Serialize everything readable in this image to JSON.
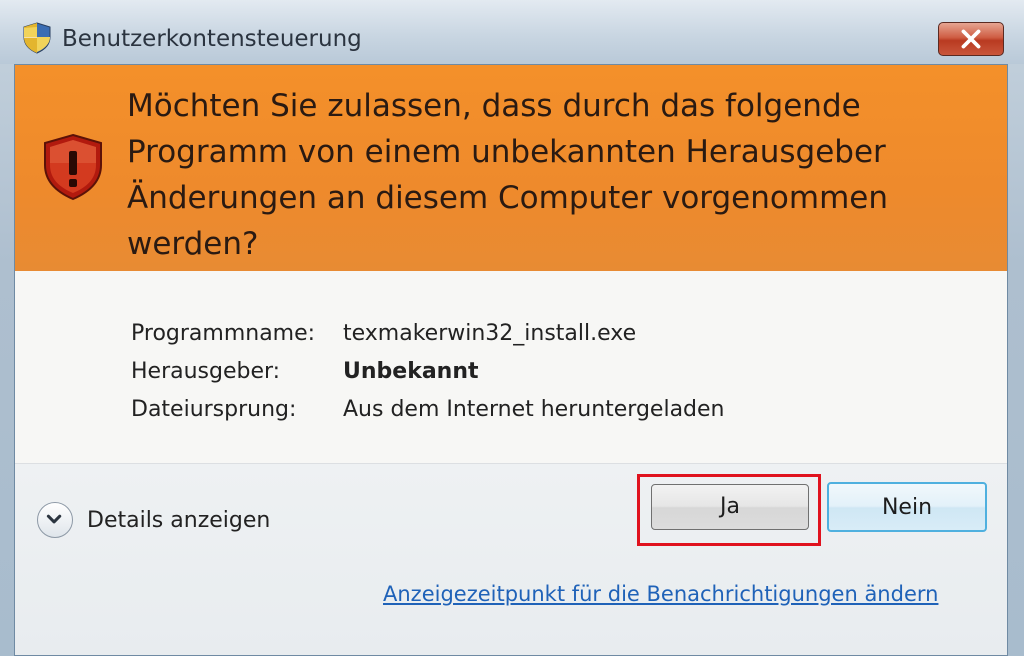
{
  "window": {
    "title": "Benutzerkontensteuerung",
    "close_label": "✕"
  },
  "banner": {
    "question": "Möchten Sie zulassen, dass durch das folgende Programm von einem unbekannten Herausgeber Änderungen an diesem Computer vorgenommen werden?",
    "icon": "warning-shield-icon",
    "color": "#f08c2e"
  },
  "info": {
    "rows": [
      {
        "label": "Programmname:",
        "value": "texmakerwin32_install.exe"
      },
      {
        "label": "Herausgeber:",
        "value": "Unbekannt"
      },
      {
        "label": "Dateiursprung:",
        "value": "Aus dem Internet heruntergeladen"
      }
    ]
  },
  "footer": {
    "details_label": "Details anzeigen",
    "yes_label": "Ja",
    "no_label": "Nein",
    "settings_link": "Anzeigezeitpunkt für die Benachrichtigungen ändern",
    "highlight_color": "#e0121e"
  }
}
